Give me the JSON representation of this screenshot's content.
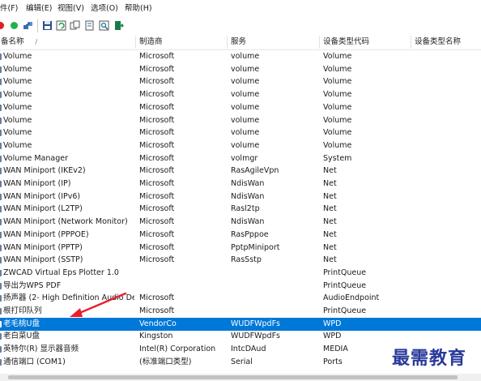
{
  "menu": [
    "件(F)",
    "编辑(E)",
    "视图(V)",
    "选项(O)",
    "帮助(H)"
  ],
  "toolbar": {
    "icons": [
      "stop-red-icon",
      "start-green-icon",
      "network-icon",
      "save-icon",
      "refresh-icon",
      "copy-icon",
      "html-report-icon",
      "properties-icon",
      "exit-icon"
    ],
    "colors": {
      "red": "#e02020",
      "green": "#22b14c",
      "selection": "#0078d7"
    }
  },
  "columns": {
    "name": "备名称",
    "manufacturer": "制造商",
    "service": "服务",
    "type_code": "设备类型代码",
    "type_name": "设备类型名称"
  },
  "rows": [
    {
      "name": "Volume",
      "manufacturer": "Microsoft",
      "service": "volume",
      "type_code": "Volume",
      "type_name": ""
    },
    {
      "name": "Volume",
      "manufacturer": "Microsoft",
      "service": "volume",
      "type_code": "Volume",
      "type_name": ""
    },
    {
      "name": "Volume",
      "manufacturer": "Microsoft",
      "service": "volume",
      "type_code": "Volume",
      "type_name": ""
    },
    {
      "name": "Volume",
      "manufacturer": "Microsoft",
      "service": "volume",
      "type_code": "Volume",
      "type_name": ""
    },
    {
      "name": "Volume",
      "manufacturer": "Microsoft",
      "service": "volume",
      "type_code": "Volume",
      "type_name": ""
    },
    {
      "name": "Volume",
      "manufacturer": "Microsoft",
      "service": "volume",
      "type_code": "Volume",
      "type_name": ""
    },
    {
      "name": "Volume",
      "manufacturer": "Microsoft",
      "service": "volume",
      "type_code": "Volume",
      "type_name": ""
    },
    {
      "name": "Volume",
      "manufacturer": "Microsoft",
      "service": "volume",
      "type_code": "Volume",
      "type_name": ""
    },
    {
      "name": "Volume Manager",
      "manufacturer": "Microsoft",
      "service": "volmgr",
      "type_code": "System",
      "type_name": ""
    },
    {
      "name": "WAN Miniport (IKEv2)",
      "manufacturer": "Microsoft",
      "service": "RasAgileVpn",
      "type_code": "Net",
      "type_name": ""
    },
    {
      "name": "WAN Miniport (IP)",
      "manufacturer": "Microsoft",
      "service": "NdisWan",
      "type_code": "Net",
      "type_name": ""
    },
    {
      "name": "WAN Miniport (IPv6)",
      "manufacturer": "Microsoft",
      "service": "NdisWan",
      "type_code": "Net",
      "type_name": ""
    },
    {
      "name": "WAN Miniport (L2TP)",
      "manufacturer": "Microsoft",
      "service": "Rasl2tp",
      "type_code": "Net",
      "type_name": ""
    },
    {
      "name": "WAN Miniport (Network Monitor)",
      "manufacturer": "Microsoft",
      "service": "NdisWan",
      "type_code": "Net",
      "type_name": ""
    },
    {
      "name": "WAN Miniport (PPPOE)",
      "manufacturer": "Microsoft",
      "service": "RasPppoe",
      "type_code": "Net",
      "type_name": ""
    },
    {
      "name": "WAN Miniport (PPTP)",
      "manufacturer": "Microsoft",
      "service": "PptpMiniport",
      "type_code": "Net",
      "type_name": ""
    },
    {
      "name": "WAN Miniport (SSTP)",
      "manufacturer": "Microsoft",
      "service": "RasSstp",
      "type_code": "Net",
      "type_name": ""
    },
    {
      "name": "ZWCAD Virtual Eps Plotter 1.0",
      "manufacturer": "",
      "service": "",
      "type_code": "PrintQueue",
      "type_name": ""
    },
    {
      "name": "导出为WPS PDF",
      "manufacturer": "",
      "service": "",
      "type_code": "PrintQueue",
      "type_name": ""
    },
    {
      "name": "扬声器 (2- High Definition Audio De...",
      "manufacturer": "Microsoft",
      "service": "",
      "type_code": "AudioEndpoint",
      "type_name": ""
    },
    {
      "name": "根打印队列",
      "manufacturer": "Microsoft",
      "service": "",
      "type_code": "PrintQueue",
      "type_name": ""
    },
    {
      "name": "老毛桃U盘",
      "manufacturer": "VendorCo",
      "service": "WUDFWpdFs",
      "type_code": "WPD",
      "type_name": "",
      "selected": true
    },
    {
      "name": "老白菜U盘",
      "manufacturer": "Kingston",
      "service": "WUDFWpdFs",
      "type_code": "WPD",
      "type_name": ""
    },
    {
      "name": "英特尔(R) 显示器音频",
      "manufacturer": "Intel(R) Corporation",
      "service": "IntcDAud",
      "type_code": "MEDIA",
      "type_name": ""
    },
    {
      "name": "通信端口 (COM1)",
      "manufacturer": "(标准端口类型)",
      "service": "Serial",
      "type_code": "Ports",
      "type_name": ""
    }
  ],
  "watermark": "最需教育"
}
